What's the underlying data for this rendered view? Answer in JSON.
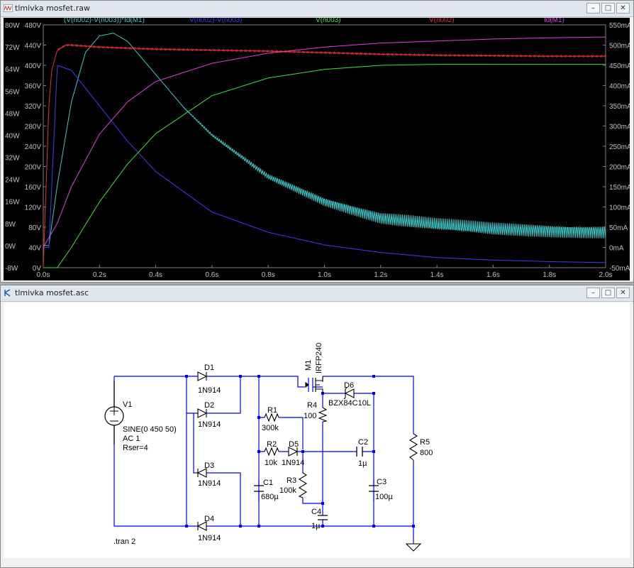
{
  "plot_window": {
    "title": "tlmivka mosfet.raw",
    "controls": {
      "minimize": "–",
      "restore": "□",
      "close": "✕"
    }
  },
  "schematic_window": {
    "title": "tlmivka mosfet.asc",
    "controls": {
      "minimize": "–",
      "restore": "□",
      "close": "✕"
    }
  },
  "trace_labels": [
    {
      "text": "(V(n002)-V(n003))*Id(M1)",
      "color": "#3fc8c8"
    },
    {
      "text": "V(n002)-V(n003)",
      "color": "#3b3bff"
    },
    {
      "text": "V(n003)",
      "color": "#3ee03e"
    },
    {
      "text": "V(n002)",
      "color": "#e83030"
    },
    {
      "text": "Id(M1)",
      "color": "#e040e0"
    }
  ],
  "chart_data": {
    "type": "line",
    "xlabel": "",
    "x_ticks": [
      "0.0s",
      "0.2s",
      "0.4s",
      "0.6s",
      "0.8s",
      "1.0s",
      "1.2s",
      "1.4s",
      "1.6s",
      "1.8s",
      "2.0s"
    ],
    "xlim": [
      0,
      2.0
    ],
    "y_left_power_ticks": [
      "80W",
      "72W",
      "64W",
      "56W",
      "48W",
      "40W",
      "32W",
      "24W",
      "16W",
      "8W",
      "0W",
      "-8W"
    ],
    "y_left_power_lim": [
      -8,
      80
    ],
    "y_left_voltage_ticks": [
      "480V",
      "440V",
      "400V",
      "360V",
      "320V",
      "280V",
      "240V",
      "200V",
      "160V",
      "120V",
      "80V",
      "40V",
      "0V"
    ],
    "y_left_voltage_lim": [
      0,
      480
    ],
    "y_right_current_ticks": [
      "550mA",
      "500mA",
      "450mA",
      "400mA",
      "350mA",
      "300mA",
      "250mA",
      "200mA",
      "150mA",
      "100mA",
      "50mA",
      "0mA",
      "-50mA"
    ],
    "y_right_current_lim": [
      -50,
      550
    ],
    "series": [
      {
        "name": "(V(n002)-V(n003))*Id(M1)",
        "unit": "W",
        "color": "#3fc8c8",
        "x": [
          0,
          0.02,
          0.05,
          0.1,
          0.15,
          0.2,
          0.25,
          0.3,
          0.4,
          0.5,
          0.6,
          0.8,
          1.0,
          1.2,
          1.4,
          1.6,
          1.8,
          2.0
        ],
        "y": [
          0,
          0,
          22,
          52,
          70,
          76,
          77,
          74,
          62,
          50,
          40,
          25,
          16,
          10,
          7.5,
          6,
          5.5,
          5
        ]
      },
      {
        "name": "V(n002)-V(n003)",
        "unit": "V",
        "color": "#3b3bff",
        "x": [
          0,
          0.02,
          0.05,
          0.1,
          0.2,
          0.3,
          0.4,
          0.6,
          0.8,
          1.0,
          1.2,
          1.4,
          1.6,
          1.8,
          2.0
        ],
        "y": [
          40,
          40,
          400,
          390,
          320,
          250,
          190,
          110,
          70,
          45,
          30,
          20,
          15,
          12,
          10
        ]
      },
      {
        "name": "V(n003)",
        "unit": "V",
        "color": "#3ee03e",
        "x": [
          0,
          0.05,
          0.1,
          0.2,
          0.3,
          0.4,
          0.6,
          0.8,
          1.0,
          1.2,
          1.4,
          1.6,
          1.8,
          2.0
        ],
        "y": [
          0,
          0,
          40,
          130,
          205,
          265,
          340,
          375,
          392,
          400,
          402,
          402,
          402,
          402
        ]
      },
      {
        "name": "V(n002)",
        "unit": "V",
        "color": "#e83030",
        "x": [
          0,
          0.02,
          0.03,
          0.05,
          0.08,
          0.1,
          0.2,
          0.4,
          0.6,
          0.8,
          1.0,
          1.2,
          1.4,
          1.6,
          1.8,
          2.0
        ],
        "y": [
          0,
          320,
          390,
          430,
          440,
          440,
          436,
          432,
          430,
          428,
          425,
          422,
          420,
          419,
          418,
          418
        ]
      },
      {
        "name": "Id(M1)",
        "unit": "mA",
        "color": "#e040e0",
        "x": [
          0,
          0.05,
          0.1,
          0.2,
          0.3,
          0.4,
          0.6,
          0.8,
          1.0,
          1.2,
          1.4,
          1.6,
          1.8,
          2.0
        ],
        "y": [
          0,
          60,
          150,
          280,
          360,
          410,
          455,
          480,
          495,
          505,
          510,
          515,
          518,
          520
        ]
      }
    ]
  },
  "schematic": {
    "V1": {
      "name": "V1",
      "value": "SINE(0 450 50)",
      "ac": "AC 1",
      "rser": "Rser=4"
    },
    "D1": {
      "name": "D1",
      "model": "1N914"
    },
    "D2": {
      "name": "D2",
      "model": "1N914"
    },
    "D3": {
      "name": "D3",
      "model": "1N914"
    },
    "D4": {
      "name": "D4",
      "model": "1N914"
    },
    "D5": {
      "name": "D5",
      "model": "1N914"
    },
    "D6": {
      "name": "D6",
      "model": "BZX84C10L"
    },
    "M1": {
      "name": "M1",
      "model": "IRFP240"
    },
    "R1": {
      "name": "R1",
      "value": "300k"
    },
    "R2": {
      "name": "R2",
      "value": "10k"
    },
    "R3": {
      "name": "R3",
      "value": "100k"
    },
    "R4": {
      "name": "R4",
      "value": "100"
    },
    "R5": {
      "name": "R5",
      "value": "800"
    },
    "C1": {
      "name": "C1",
      "value": "680µ"
    },
    "C2": {
      "name": "C2",
      "value": "1µ"
    },
    "C3": {
      "name": "C3",
      "value": "100µ"
    },
    "C4": {
      "name": "C4",
      "value": "1µ"
    },
    "directive": ".tran 2"
  }
}
